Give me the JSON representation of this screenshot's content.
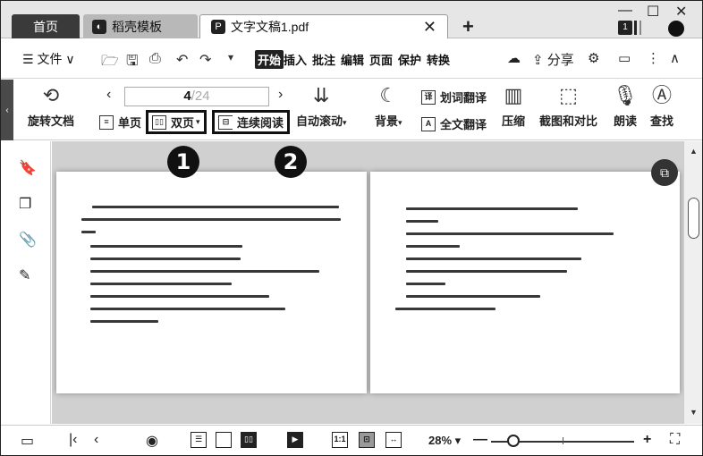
{
  "tabs": {
    "home": "首页",
    "templates": "稻壳模板",
    "document": "文字文稿1.pdf",
    "add": "+",
    "close": "✕"
  },
  "window": {
    "minimize": "—",
    "maximize": "☐",
    "close": "✕",
    "badge": "1"
  },
  "menubar": {
    "file": "☰ 文件 ∨",
    "tabs": [
      "开始",
      "插入",
      "批注",
      "编辑",
      "页面",
      "保护",
      "转换"
    ],
    "active_tab": "开始",
    "share": "分享"
  },
  "ribbon": {
    "rotate": "旋转文档",
    "single_page": "单页",
    "double_page": "双页",
    "continuous": "连续阅读",
    "auto_scroll": "自动滚动",
    "page_current": "4",
    "page_total": "/24",
    "background": "背景",
    "word_translate": "划词翻译",
    "full_translate": "全文翻译",
    "compress": "压缩",
    "screenshot_compare": "截图和对比",
    "read_aloud": "朗读",
    "find": "查找"
  },
  "callouts": [
    "1",
    "2"
  ],
  "statusbar": {
    "zoom": "28%",
    "zoom_level": 0.12
  },
  "icons": {
    "rotate": "rotate-icon",
    "bookmark": "bookmark-icon",
    "pages": "pages-icon",
    "attachment": "paperclip-icon",
    "sign": "pen-icon"
  }
}
